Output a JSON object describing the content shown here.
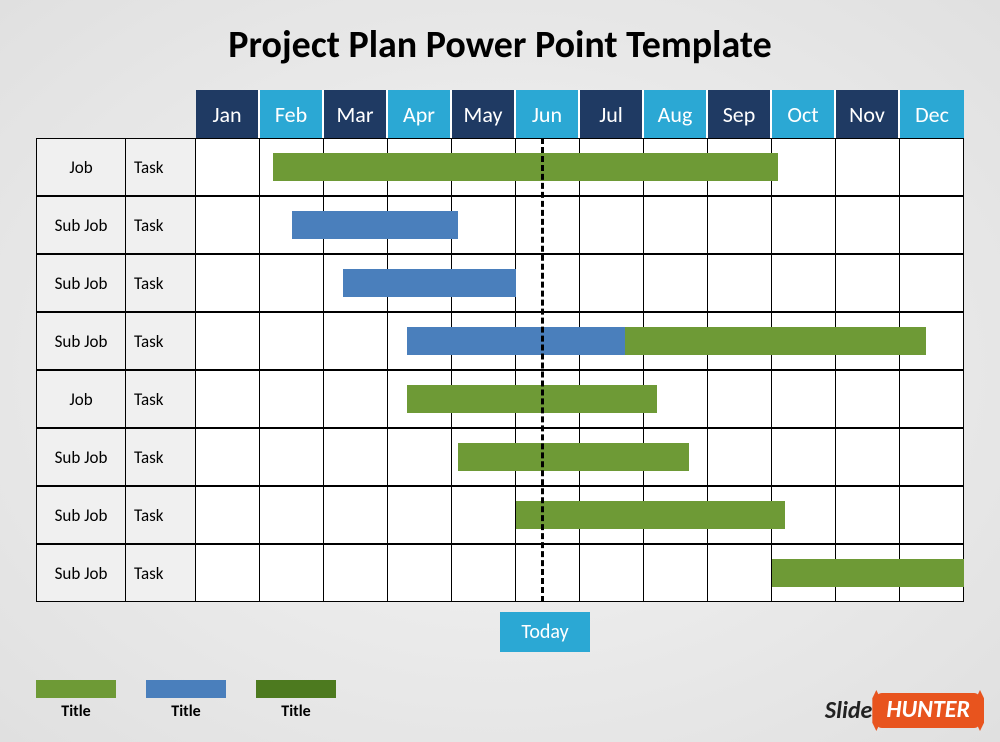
{
  "title": "Project Plan Power Point Template",
  "months": [
    "Jan",
    "Feb",
    "Mar",
    "Apr",
    "May",
    "Jun",
    "Jul",
    "Aug",
    "Sep",
    "Oct",
    "Nov",
    "Dec"
  ],
  "today_label": "Today",
  "rows": [
    {
      "job": "Job",
      "task": "Task"
    },
    {
      "job": "Sub Job",
      "task": "Task"
    },
    {
      "job": "Sub Job",
      "task": "Task"
    },
    {
      "job": "Sub Job",
      "task": "Task"
    },
    {
      "job": "Job",
      "task": "Task"
    },
    {
      "job": "Sub Job",
      "task": "Task"
    },
    {
      "job": "Sub Job",
      "task": "Task"
    },
    {
      "job": "Sub Job",
      "task": "Task"
    }
  ],
  "legend": [
    {
      "color": "#6e9a36",
      "label": "Title"
    },
    {
      "color": "#4a7fbc",
      "label": "Title"
    },
    {
      "color": "#4d7a1f",
      "label": "Title"
    }
  ],
  "brand": {
    "left": "Slide",
    "right": "HUNTER"
  },
  "chart_data": {
    "type": "gantt",
    "title": "Project Plan Power Point Template",
    "x_categories": [
      "Jan",
      "Feb",
      "Mar",
      "Apr",
      "May",
      "Jun",
      "Jul",
      "Aug",
      "Sep",
      "Oct",
      "Nov",
      "Dec"
    ],
    "today_marker": 5.4,
    "tasks": [
      {
        "row": 0,
        "job": "Job",
        "task": "Task",
        "segments": [
          {
            "start": 1.2,
            "end": 5.4,
            "color": "green"
          },
          {
            "start": 5.4,
            "end": 9.1,
            "color": "green"
          }
        ]
      },
      {
        "row": 1,
        "job": "Sub Job",
        "task": "Task",
        "segments": [
          {
            "start": 1.5,
            "end": 4.1,
            "color": "blue"
          }
        ]
      },
      {
        "row": 2,
        "job": "Sub Job",
        "task": "Task",
        "segments": [
          {
            "start": 2.3,
            "end": 5.0,
            "color": "blue"
          }
        ]
      },
      {
        "row": 3,
        "job": "Sub Job",
        "task": "Task",
        "segments": [
          {
            "start": 3.3,
            "end": 6.7,
            "color": "blue"
          },
          {
            "start": 6.7,
            "end": 11.4,
            "color": "green"
          }
        ]
      },
      {
        "row": 4,
        "job": "Job",
        "task": "Task",
        "segments": [
          {
            "start": 3.3,
            "end": 7.2,
            "color": "green"
          }
        ]
      },
      {
        "row": 5,
        "job": "Sub Job",
        "task": "Task",
        "segments": [
          {
            "start": 4.1,
            "end": 7.7,
            "color": "green"
          }
        ]
      },
      {
        "row": 6,
        "job": "Sub Job",
        "task": "Task",
        "segments": [
          {
            "start": 5.0,
            "end": 9.2,
            "color": "green"
          }
        ]
      },
      {
        "row": 7,
        "job": "Sub Job",
        "task": "Task",
        "segments": [
          {
            "start": 9.0,
            "end": 12.0,
            "color": "green"
          }
        ]
      }
    ]
  }
}
